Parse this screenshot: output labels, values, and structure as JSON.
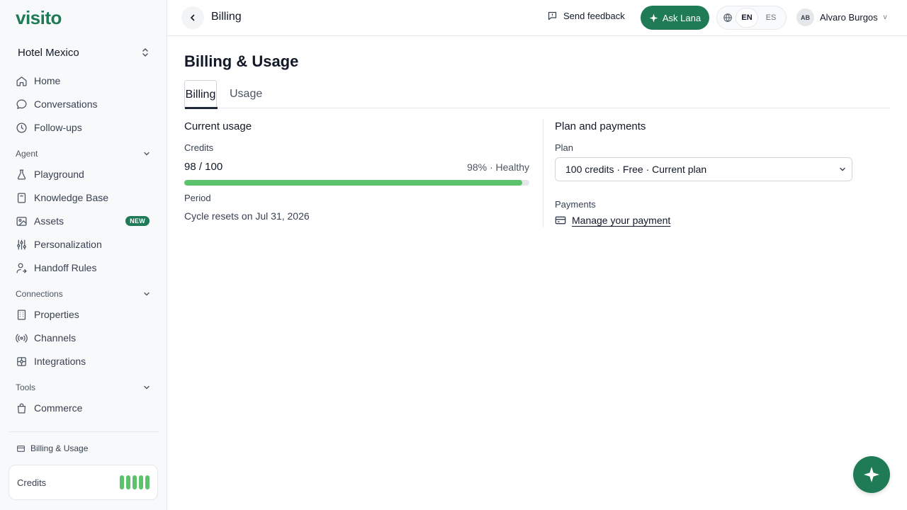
{
  "brand": {
    "logo_text": "visito",
    "accent_color": "#1f7a56",
    "progress_color": "#5cc26b"
  },
  "sidebar": {
    "hotel_name": "Hotel Mexico",
    "main_items": [
      {
        "label": "Home",
        "icon": "home-icon"
      },
      {
        "label": "Conversations",
        "icon": "chat-bubble-icon"
      },
      {
        "label": "Follow-ups",
        "icon": "clock-icon"
      }
    ],
    "sections": {
      "agent": {
        "label": "Agent",
        "items": [
          {
            "label": "Playground",
            "icon": "flask-icon"
          },
          {
            "label": "Knowledge Base",
            "icon": "book-icon"
          },
          {
            "label": "Assets",
            "icon": "image-icon",
            "badge": "NEW"
          },
          {
            "label": "Personalization",
            "icon": "sliders-icon"
          },
          {
            "label": "Handoff Rules",
            "icon": "user-handoff-icon"
          }
        ]
      },
      "connections": {
        "label": "Connections",
        "items": [
          {
            "label": "Properties",
            "icon": "building-icon"
          },
          {
            "label": "Channels",
            "icon": "broadcast-icon"
          },
          {
            "label": "Integrations",
            "icon": "puzzle-icon"
          }
        ]
      },
      "tools": {
        "label": "Tools",
        "items": [
          {
            "label": "Commerce",
            "icon": "shopping-bag-icon"
          }
        ]
      }
    },
    "billing_link": "Billing & Usage",
    "credits_card_label": "Credits"
  },
  "topbar": {
    "title": "Billing",
    "send_feedback": "Send feedback",
    "ask_lana": "Ask Lana",
    "languages": [
      "EN",
      "ES"
    ],
    "active_language": "EN",
    "user_initials": "AB",
    "user_name": "Alvaro Burgos",
    "user_caret": "v"
  },
  "page": {
    "title": "Billing & Usage",
    "tabs": [
      "Billing",
      "Usage"
    ],
    "active_tab": "Billing",
    "current_usage": {
      "heading": "Current usage",
      "credits_label": "Credits",
      "credits_value": "98 / 100",
      "credits_status": "98% · Healthy",
      "progress_fraction": 0.98,
      "period_label": "Period",
      "period_value": "Cycle resets on Jul 31, 2026"
    },
    "plan_payments": {
      "heading": "Plan and payments",
      "plan_label": "Plan",
      "plan_selected": "100 credits · Free · Current plan",
      "payments_label": "Payments",
      "manage_payment": "Manage your payment"
    }
  }
}
